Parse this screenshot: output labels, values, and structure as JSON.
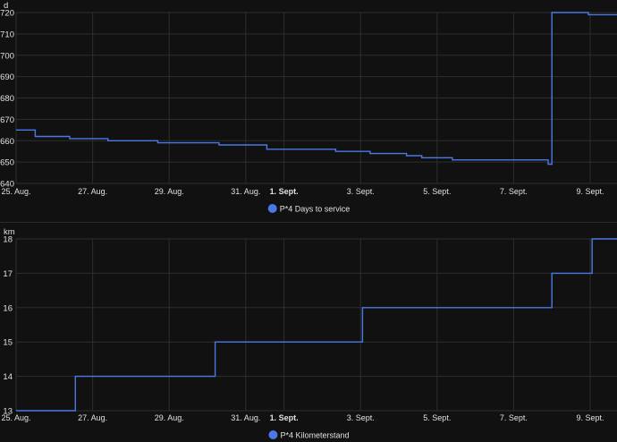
{
  "colors": {
    "background": "#111111",
    "grid": "#2e2e2e",
    "line": "#4a78e6",
    "text": "#e1e1e1"
  },
  "chart_data": [
    {
      "type": "line",
      "step": true,
      "unit_label": "d",
      "x_ticks": [
        "25. Aug.",
        "27. Aug.",
        "29. Aug.",
        "31. Aug.",
        "1. Sept.",
        "3. Sept.",
        "5. Sept.",
        "7. Sept.",
        "9. Sept."
      ],
      "x_tick_days": [
        0,
        2,
        4,
        6,
        7,
        9,
        11,
        13,
        15
      ],
      "bold_tick": "1. Sept.",
      "x_range_days": [
        0,
        15.7
      ],
      "y_ticks": [
        640,
        650,
        660,
        670,
        680,
        690,
        700,
        710,
        720
      ],
      "ylim": [
        640,
        720
      ],
      "grid": true,
      "legend_position": "bottom-center",
      "series": [
        {
          "name": "P*4 Days to service",
          "points": [
            [
              0,
              665
            ],
            [
              0.5,
              665
            ],
            [
              0.5,
              662
            ],
            [
              1.4,
              662
            ],
            [
              1.4,
              661
            ],
            [
              2.4,
              661
            ],
            [
              2.4,
              660
            ],
            [
              3.7,
              660
            ],
            [
              3.7,
              659
            ],
            [
              5.3,
              659
            ],
            [
              5.3,
              658
            ],
            [
              6.55,
              658
            ],
            [
              6.55,
              656
            ],
            [
              8.35,
              656
            ],
            [
              8.35,
              655
            ],
            [
              9.25,
              655
            ],
            [
              9.25,
              654
            ],
            [
              10.2,
              654
            ],
            [
              10.2,
              653
            ],
            [
              10.6,
              653
            ],
            [
              10.6,
              652
            ],
            [
              11.4,
              652
            ],
            [
              11.4,
              651
            ],
            [
              13.9,
              651
            ],
            [
              13.9,
              649
            ],
            [
              14.0,
              649
            ],
            [
              14.0,
              720
            ],
            [
              14.95,
              720
            ],
            [
              14.95,
              719
            ],
            [
              15.7,
              719
            ]
          ]
        }
      ]
    },
    {
      "type": "line",
      "step": true,
      "unit_label": "km",
      "x_ticks": [
        "25. Aug.",
        "27. Aug.",
        "29. Aug.",
        "31. Aug.",
        "1. Sept.",
        "3. Sept.",
        "5. Sept.",
        "7. Sept.",
        "9. Sept."
      ],
      "x_tick_days": [
        0,
        2,
        4,
        6,
        7,
        9,
        11,
        13,
        15
      ],
      "bold_tick": "1. Sept.",
      "x_range_days": [
        0,
        15.7
      ],
      "y_ticks": [
        13,
        14,
        15,
        16,
        17,
        18
      ],
      "ylim": [
        13,
        18
      ],
      "grid": true,
      "legend_position": "bottom-center",
      "series": [
        {
          "name": "P*4 Kilometerstand",
          "points": [
            [
              0,
              13
            ],
            [
              1.55,
              13
            ],
            [
              1.55,
              14
            ],
            [
              5.2,
              14
            ],
            [
              5.2,
              15
            ],
            [
              9.05,
              15
            ],
            [
              9.05,
              16
            ],
            [
              14.0,
              16
            ],
            [
              14.0,
              17
            ],
            [
              15.05,
              17
            ],
            [
              15.05,
              18
            ],
            [
              15.7,
              18
            ]
          ]
        }
      ]
    }
  ]
}
